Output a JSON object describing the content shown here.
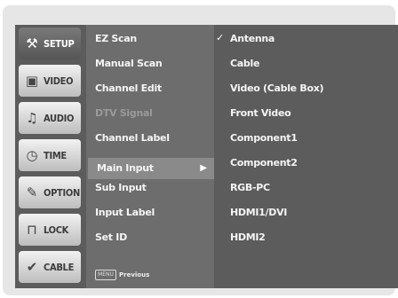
{
  "tabs": [
    {
      "label": "SETUP",
      "icon": "wrench-icon"
    },
    {
      "label": "VIDEO",
      "icon": "tv-icon"
    },
    {
      "label": "AUDIO",
      "icon": "speaker-icon"
    },
    {
      "label": "TIME",
      "icon": "clock-icon"
    },
    {
      "label": "OPTION",
      "icon": "wrench-option-icon"
    },
    {
      "label": "LOCK",
      "icon": "lock-icon"
    },
    {
      "label": "CABLE",
      "icon": "check-cable-icon"
    }
  ],
  "active_tab": "SETUP",
  "submenu": [
    {
      "label": "EZ Scan",
      "enabled": true
    },
    {
      "label": "Manual Scan",
      "enabled": true
    },
    {
      "label": "Channel Edit",
      "enabled": true
    },
    {
      "label": "DTV Signal",
      "enabled": false
    },
    {
      "label": "Channel Label",
      "enabled": true
    },
    {
      "label": "Main Input",
      "enabled": true,
      "selected": true
    },
    {
      "label": "Sub Input",
      "enabled": true
    },
    {
      "label": "Input Label",
      "enabled": true
    },
    {
      "label": "Set ID",
      "enabled": true
    }
  ],
  "footer": {
    "key_label": "MENU",
    "text": "Previous"
  },
  "options": [
    {
      "label": "Antenna",
      "checked": true
    },
    {
      "label": "Cable"
    },
    {
      "label": "Video (Cable Box)"
    },
    {
      "label": "Front Video"
    },
    {
      "label": "Component1"
    },
    {
      "label": "Component2"
    },
    {
      "label": "RGB-PC"
    },
    {
      "label": "HDMI1/DVI"
    },
    {
      "label": "HDMI2"
    }
  ],
  "colors": {
    "panel": "#5c5c5c",
    "submenu": "#6d6d6d",
    "selection": "#8a8a8a",
    "frame": "#e6e6e6"
  }
}
